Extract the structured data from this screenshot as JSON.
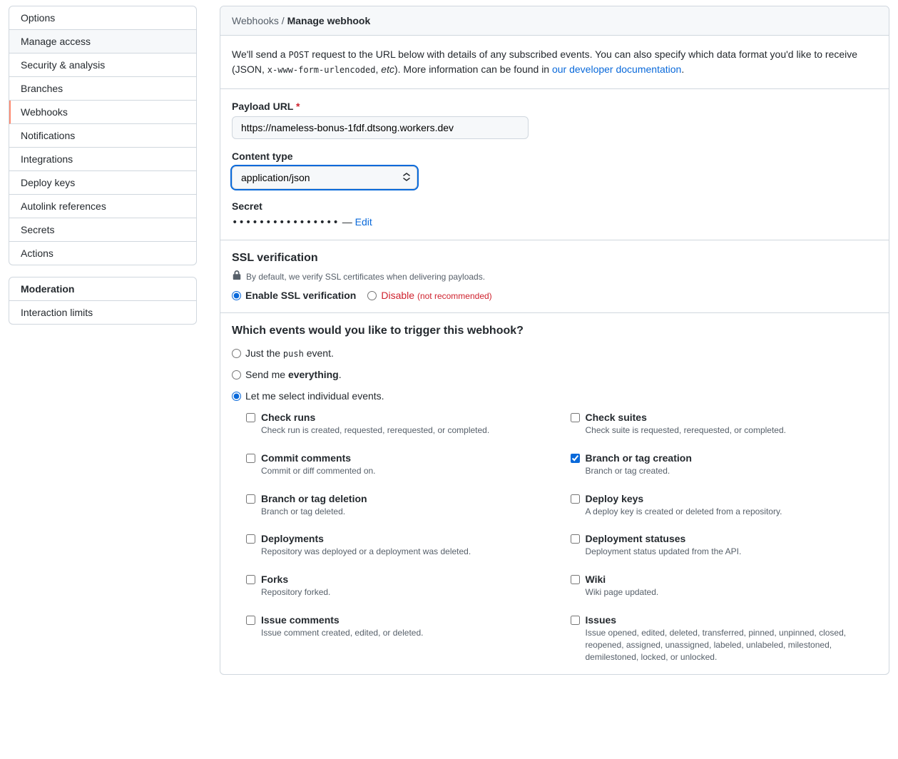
{
  "sidebar": {
    "menu1": [
      {
        "label": "Options"
      },
      {
        "label": "Manage access",
        "muted": true
      },
      {
        "label": "Security & analysis"
      },
      {
        "label": "Branches"
      },
      {
        "label": "Webhooks",
        "selected": true
      },
      {
        "label": "Notifications"
      },
      {
        "label": "Integrations"
      },
      {
        "label": "Deploy keys"
      },
      {
        "label": "Autolink references"
      },
      {
        "label": "Secrets"
      },
      {
        "label": "Actions"
      }
    ],
    "menu2_header": "Moderation",
    "menu2": [
      {
        "label": "Interaction limits"
      }
    ]
  },
  "breadcrumb": {
    "root": "Webhooks",
    "sep": " / ",
    "current": "Manage webhook"
  },
  "intro": {
    "t1": "We'll send a ",
    "code1": "POST",
    "t2": " request to the URL below with details of any subscribed events. You can also specify which data format you'd like to receive (JSON, ",
    "code2": "x-www-form-urlencoded",
    "t3": ", ",
    "em": "etc",
    "t4": "). More information can be found in ",
    "link": "our developer documentation",
    "t5": "."
  },
  "form": {
    "payload_label": "Payload URL",
    "payload_value": "https://nameless-bonus-1fdf.dtsong.workers.dev",
    "content_type_label": "Content type",
    "content_type_value": "application/json",
    "secret_label": "Secret",
    "secret_dots": "••••••••••••••••",
    "secret_sep": " — ",
    "secret_edit": "Edit"
  },
  "ssl": {
    "heading": "SSL verification",
    "note": "By default, we verify SSL certificates when delivering payloads.",
    "enable": "Enable SSL verification",
    "disable": "Disable",
    "disable_note": "(not recommended)"
  },
  "events": {
    "heading": "Which events would you like to trigger this webhook?",
    "o1a": "Just the ",
    "o1b": "push",
    "o1c": " event.",
    "o2a": "Send me ",
    "o2b": "everything",
    "o2c": ".",
    "o3": "Let me select individual events.",
    "list": [
      {
        "label": "Check runs",
        "desc": "Check run is created, requested, rerequested, or completed.",
        "checked": false
      },
      {
        "label": "Check suites",
        "desc": "Check suite is requested, rerequested, or completed.",
        "checked": false
      },
      {
        "label": "Commit comments",
        "desc": "Commit or diff commented on.",
        "checked": false
      },
      {
        "label": "Branch or tag creation",
        "desc": "Branch or tag created.",
        "checked": true
      },
      {
        "label": "Branch or tag deletion",
        "desc": "Branch or tag deleted.",
        "checked": false
      },
      {
        "label": "Deploy keys",
        "desc": "A deploy key is created or deleted from a repository.",
        "checked": false
      },
      {
        "label": "Deployments",
        "desc": "Repository was deployed or a deployment was deleted.",
        "checked": false
      },
      {
        "label": "Deployment statuses",
        "desc": "Deployment status updated from the API.",
        "checked": false
      },
      {
        "label": "Forks",
        "desc": "Repository forked.",
        "checked": false
      },
      {
        "label": "Wiki",
        "desc": "Wiki page updated.",
        "checked": false
      },
      {
        "label": "Issue comments",
        "desc": "Issue comment created, edited, or deleted.",
        "checked": false
      },
      {
        "label": "Issues",
        "desc": "Issue opened, edited, deleted, transferred, pinned, unpinned, closed, reopened, assigned, unassigned, labeled, unlabeled, milestoned, demilestoned, locked, or unlocked.",
        "checked": false
      }
    ]
  }
}
